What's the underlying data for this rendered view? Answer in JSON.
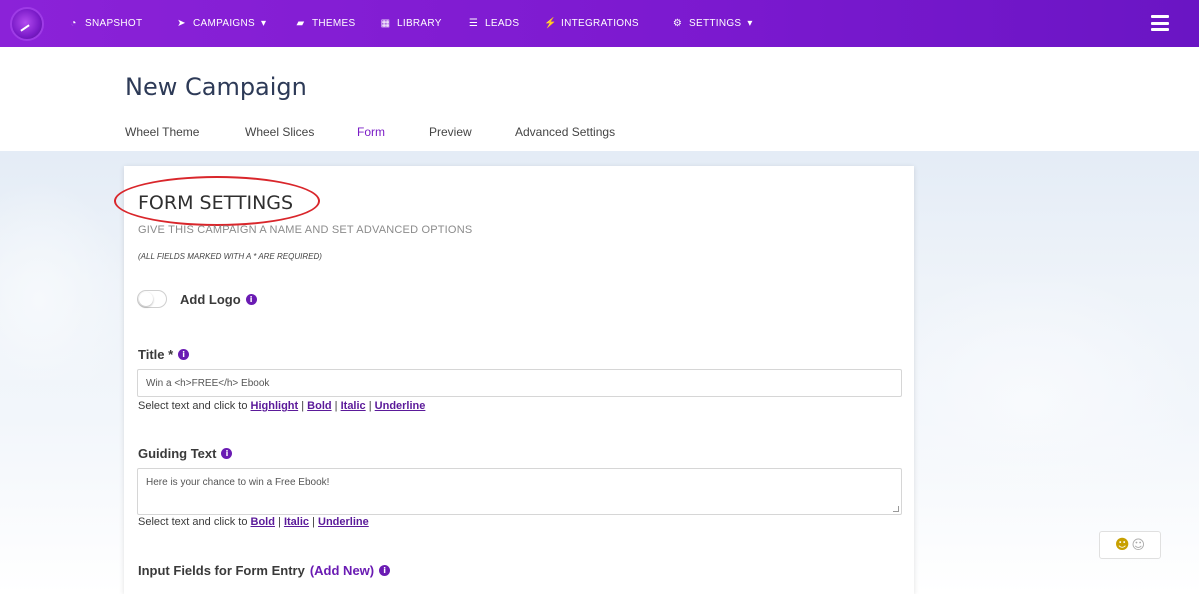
{
  "nav": {
    "items": [
      {
        "label": "SNAPSHOT",
        "icon": "dashboard-icon"
      },
      {
        "label": "CAMPAIGNS",
        "icon": "send-icon",
        "dropdown": true
      },
      {
        "label": "THEMES",
        "icon": "image-icon"
      },
      {
        "label": "LIBRARY",
        "icon": "library-icon"
      },
      {
        "label": "LEADS",
        "icon": "list-icon"
      },
      {
        "label": "INTEGRATIONS",
        "icon": "plug-icon"
      },
      {
        "label": "SETTINGS",
        "icon": "cogs-icon",
        "dropdown": true
      }
    ],
    "dropdown_caret": "▾",
    "bg_color": "#7b19cf"
  },
  "page": {
    "title": "New Campaign",
    "tabs": [
      {
        "label": "Wheel Theme",
        "active": false
      },
      {
        "label": "Wheel Slices",
        "active": false
      },
      {
        "label": "Form",
        "active": true
      },
      {
        "label": "Preview",
        "active": false
      },
      {
        "label": "Advanced Settings",
        "active": false
      }
    ]
  },
  "form": {
    "section_title": "FORM SETTINGS",
    "subtitle": "GIVE THIS CAMPAIGN A NAME AND SET ADVANCED OPTIONS",
    "required_note": "(ALL FIELDS MARKED WITH A * ARE REQUIRED)",
    "add_logo_label": "Add Logo",
    "title_label": "Title *",
    "title_value": "Win a <h>FREE</h> Ebook",
    "title_helper_prefix": "Select text and click to",
    "title_helper_links": [
      "Highlight",
      "Bold",
      "Italic",
      "Underline"
    ],
    "guiding_label": "Guiding Text",
    "guiding_value": "Here is your chance to win a Free Ebook!",
    "guiding_helper_prefix": "Select text and click to",
    "guiding_helper_links": [
      "Bold",
      "Italic",
      "Underline"
    ],
    "input_fields_label": "Input Fields for Form Entry",
    "add_new_label": "(Add New)",
    "info_glyph": "i",
    "separator": "|"
  },
  "accent_color": "#7a1cc6"
}
